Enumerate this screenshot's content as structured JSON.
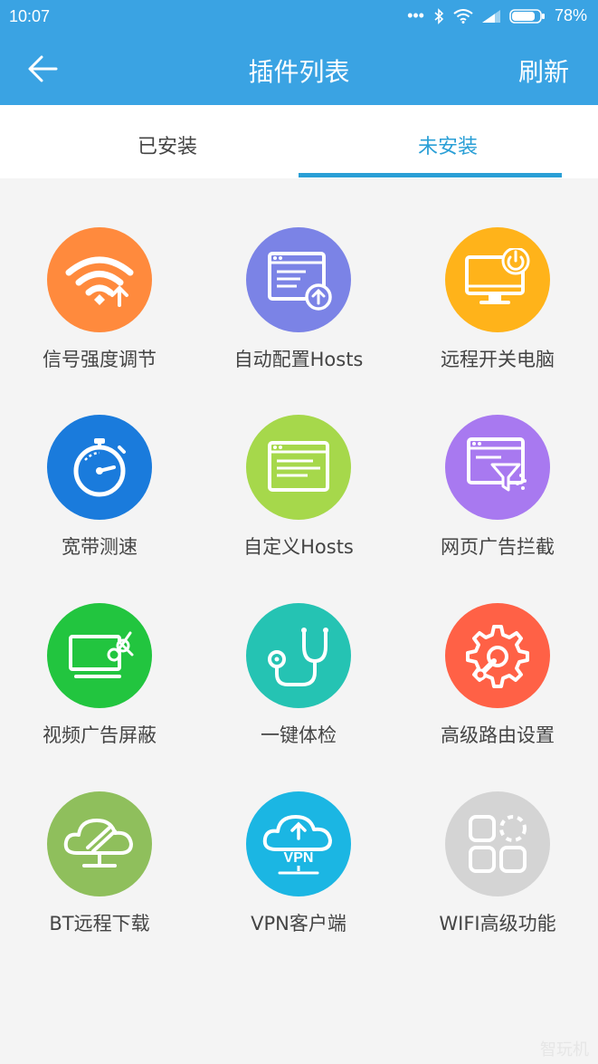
{
  "status": {
    "time": "10:07",
    "battery": "78%"
  },
  "appbar": {
    "title": "插件列表",
    "refresh_label": "刷新"
  },
  "tabs": [
    {
      "label": "已安装",
      "active": false
    },
    {
      "label": "未安装",
      "active": true
    }
  ],
  "plugins": [
    {
      "label": "信号强度调节",
      "color": "#ff8a3d",
      "icon": "wifi-signal-icon"
    },
    {
      "label": "自动配置Hosts",
      "color": "#7b83e6",
      "icon": "auto-hosts-icon"
    },
    {
      "label": "远程开关电脑",
      "color": "#ffb31a",
      "icon": "remote-power-pc-icon"
    },
    {
      "label": "宽带测速",
      "color": "#1a7bdc",
      "icon": "stopwatch-icon"
    },
    {
      "label": "自定义Hosts",
      "color": "#a6d84b",
      "icon": "custom-hosts-icon"
    },
    {
      "label": "网页广告拦截",
      "color": "#a879f0",
      "icon": "ad-filter-icon"
    },
    {
      "label": "视频广告屏蔽",
      "color": "#22c53f",
      "icon": "video-ad-block-icon"
    },
    {
      "label": "一键体检",
      "color": "#25c3b3",
      "icon": "stethoscope-icon"
    },
    {
      "label": "高级路由设置",
      "color": "#ff6146",
      "icon": "gear-wrench-icon"
    },
    {
      "label": "BT远程下载",
      "color": "#8fbf5c",
      "icon": "bt-cloud-icon"
    },
    {
      "label": "VPN客户端",
      "color": "#1bb6e3",
      "icon": "vpn-cloud-icon"
    },
    {
      "label": "WIFI高级功能",
      "color": "#d4d4d4",
      "icon": "apps-grid-icon"
    }
  ],
  "watermark": "智玩机"
}
